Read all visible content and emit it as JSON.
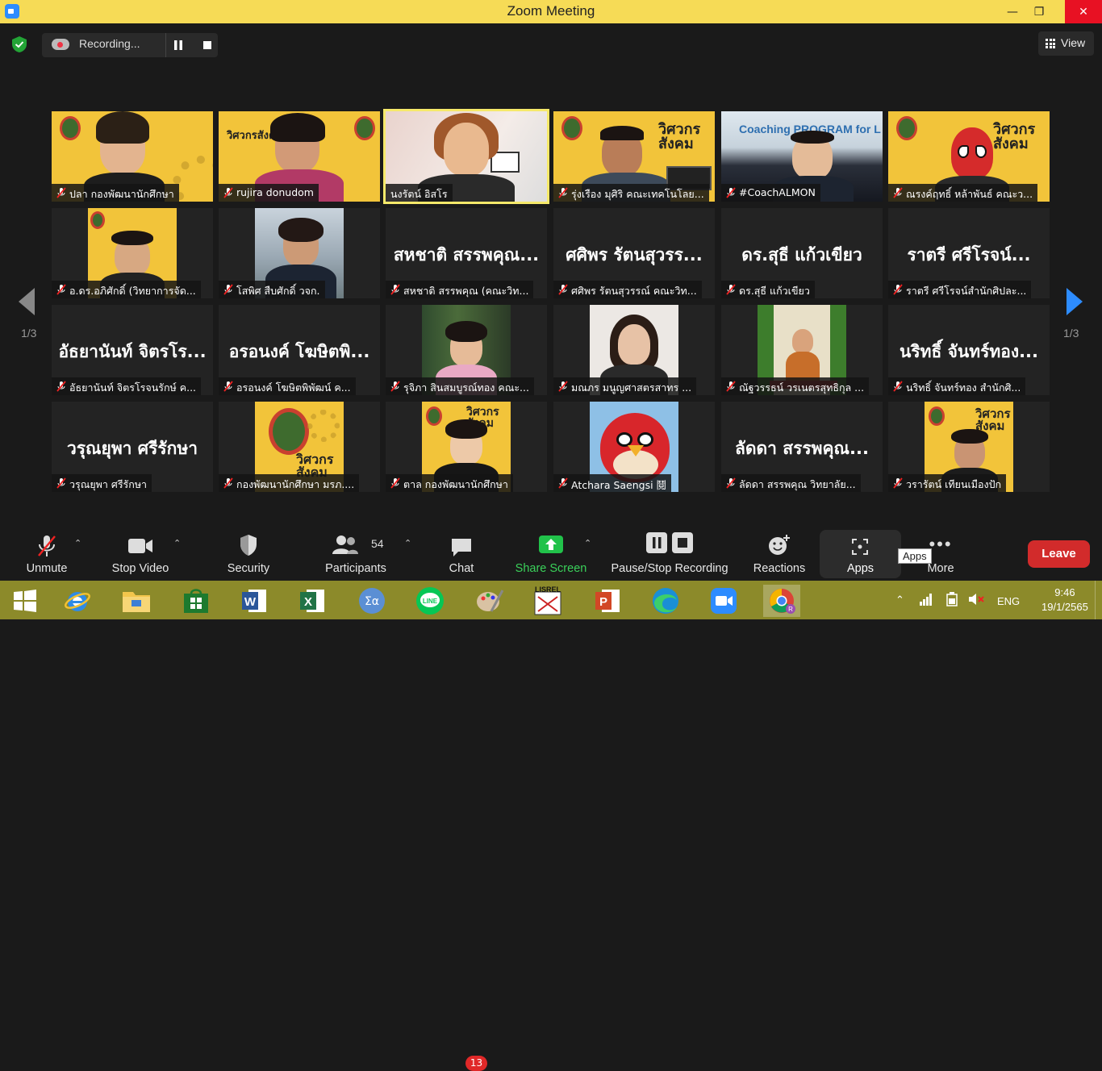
{
  "window": {
    "title": "Zoom Meeting"
  },
  "topbar": {
    "recording_label": "Recording...",
    "view_label": "View"
  },
  "pager": {
    "left": "1/3",
    "right": "1/3"
  },
  "tiles": [
    {
      "name": "ปลา กองพัฒนานักศึกษา"
    },
    {
      "name": "rujira donudom"
    },
    {
      "name": "นงรัตน์ อิสโร"
    },
    {
      "name": "รุ่งเรือง มุศิริ คณะเทคโนโลย..."
    },
    {
      "name": "#CoachALMON",
      "banner": "Coaching PROGRAM for L"
    },
    {
      "name": "ณรงค์ฤทธิ์ หล้าพันธ์ คณะว..."
    },
    {
      "name": "อ.ดร.อภิศักดิ์ (วิทยาการจัด..."
    },
    {
      "name": "โสพิศ สืบศักดิ์ วจก."
    },
    {
      "name": "สหชาติ สรรพคุณ (คณะวิท...",
      "big": "สหชาติ สรรพคุณ..."
    },
    {
      "name": "ศศิพร รัตนสุวรรณ์ คณะวิท...",
      "big": "ศศิพร รัตนสุวรร..."
    },
    {
      "name": "ดร.สุธี แก้วเขียว",
      "big": "ดร.สุธี แก้วเขียว"
    },
    {
      "name": "ราตรี ศรีโรจน์สำนักศิปละ...",
      "big": "ราตรี ศรีโรจน์..."
    },
    {
      "name": "อัธยานันท์ จิตรโรจนรักษ์ ค...",
      "big": "อัธยานันท์ จิตรโร..."
    },
    {
      "name": "อรอนงค์ โฆษิตพิพัฒน์ ค...",
      "big": "อรอนงค์ โฆษิตพิ..."
    },
    {
      "name": "รุจิภา สินสมบูรณ์ทอง คณะ..."
    },
    {
      "name": "มณภร มนูญศาสตรสาทร ..."
    },
    {
      "name": "ณัฐวรรธน์ วรเนตรสุทธิกุล ..."
    },
    {
      "name": "นริทธิ์ จันทร์ทอง สำนักศิ...",
      "big": "นริทธิ์ จันทร์ทอง..."
    },
    {
      "name": "วรุณยุพา ศรีรักษา",
      "big": "วรุณยุพา ศรีรักษา"
    },
    {
      "name": "กองพัฒนานักศึกษา มรภ...."
    },
    {
      "name": "ตาล กองพัฒนานักศึกษา"
    },
    {
      "name": "Atchara Saengsi 鬩"
    },
    {
      "name": "ลัดดา สรรพคุณ วิทยาลัย...",
      "big": "ลัดดา สรรพคุณ..."
    },
    {
      "name": "วรารัตน์ เทียนเมืองปัก"
    }
  ],
  "brand_text": "วิศวกรสังคม",
  "toolbar": {
    "unmute": "Unmute",
    "stop_video": "Stop Video",
    "security": "Security",
    "participants": "Participants",
    "participants_count": "54",
    "chat": "Chat",
    "chat_badge": "13",
    "share": "Share Screen",
    "record": "Pause/Stop Recording",
    "reactions": "Reactions",
    "apps": "Apps",
    "more": "More",
    "leave": "Leave",
    "apps_tooltip": "Apps"
  },
  "taskbar": {
    "lang": "ENG",
    "time": "9:46",
    "date": "19/1/2565"
  },
  "colors": {
    "title_bar": "#f6db56",
    "leave": "#d22b2b",
    "share": "#21c24a",
    "taskbar": "#8c8a2a"
  }
}
